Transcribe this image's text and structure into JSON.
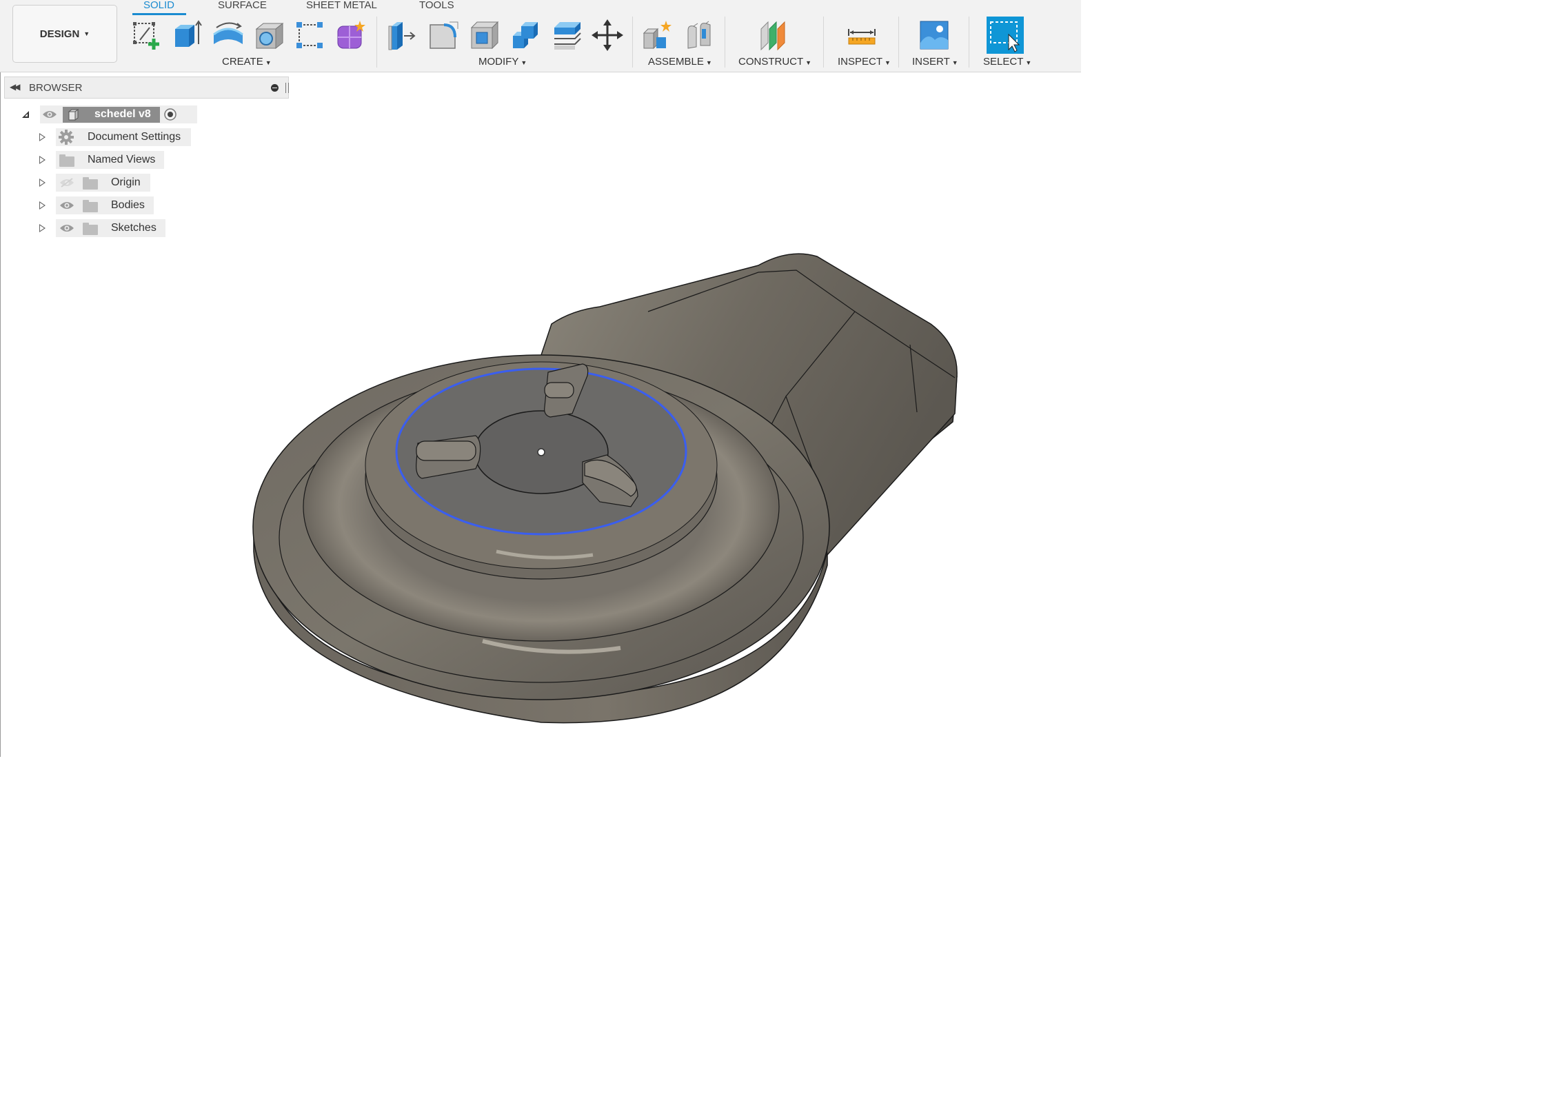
{
  "toolbar": {
    "workspace": "DESIGN",
    "tabs": [
      "SOLID",
      "SURFACE",
      "SHEET METAL",
      "TOOLS"
    ],
    "active_tab": "SOLID",
    "groups": {
      "create": "CREATE",
      "modify": "MODIFY",
      "assemble": "ASSEMBLE",
      "construct": "CONSTRUCT",
      "inspect": "INSPECT",
      "insert": "INSERT",
      "select": "SELECT"
    },
    "icons": {
      "create": [
        "create-sketch-icon",
        "extrude-icon",
        "revolve-icon",
        "hole-icon",
        "pattern-icon",
        "create-form-icon"
      ],
      "modify": [
        "press-pull-icon",
        "fillet-icon",
        "shell-icon",
        "combine-icon",
        "offset-face-icon",
        "move-icon"
      ],
      "assemble": [
        "new-component-icon",
        "joint-icon"
      ],
      "construct": [
        "offset-plane-icon"
      ],
      "inspect": [
        "measure-icon"
      ],
      "insert": [
        "insert-image-icon"
      ],
      "select": [
        "select-window-icon"
      ]
    }
  },
  "browser": {
    "title": "BROWSER",
    "root": "schedel v8",
    "items": [
      {
        "label": "Document Settings"
      },
      {
        "label": "Named Views"
      },
      {
        "label": "Origin"
      },
      {
        "label": "Bodies"
      },
      {
        "label": "Sketches"
      }
    ]
  },
  "colors": {
    "accent": "#1a8bd0",
    "body": "#7a756b",
    "selection_edge": "#3a5ef0"
  }
}
